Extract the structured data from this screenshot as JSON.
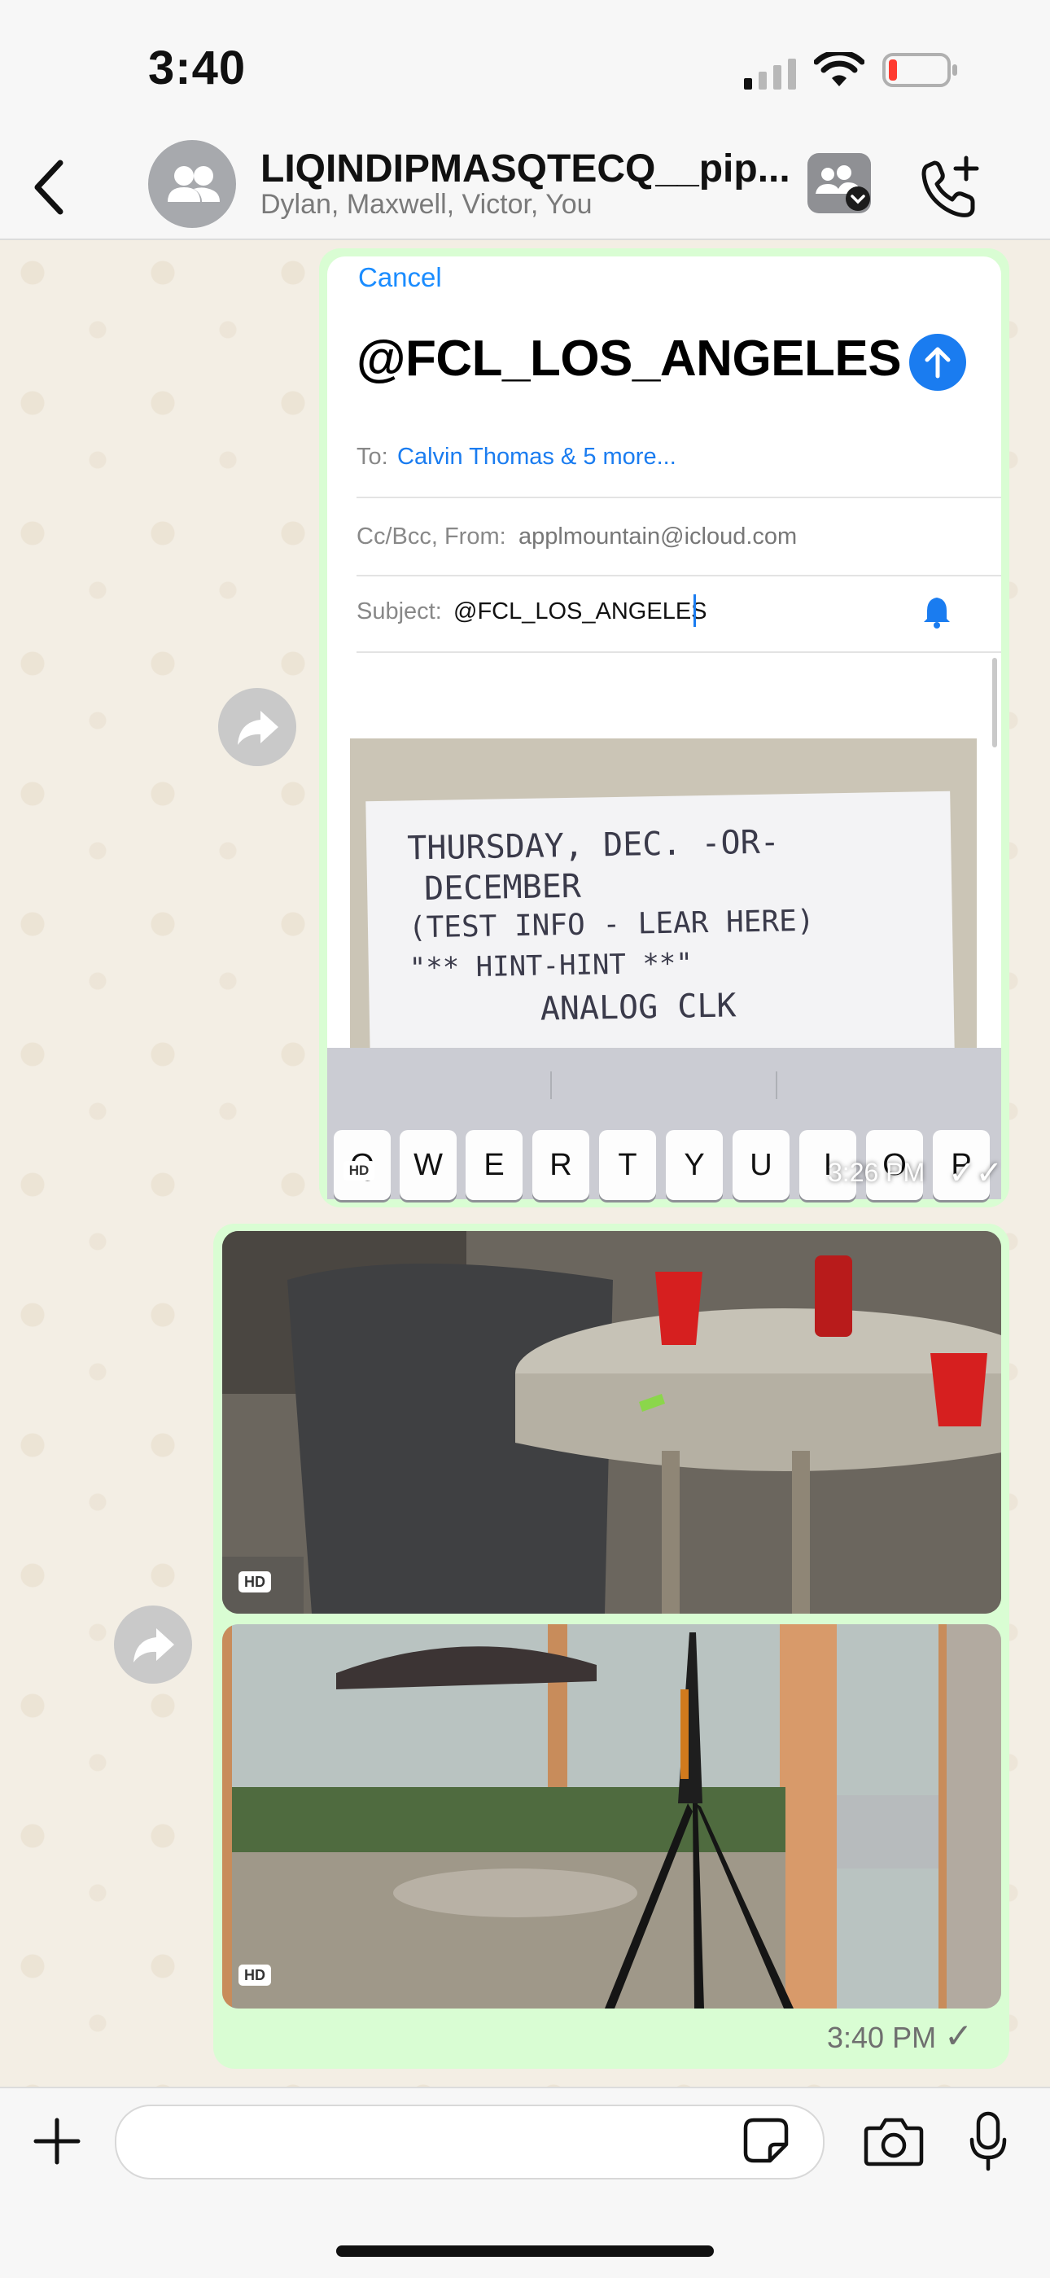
{
  "status_bar": {
    "time": "3:40",
    "icons": [
      "cellular-signal-icon",
      "wifi-icon",
      "battery-low-icon"
    ]
  },
  "header": {
    "title": "LIQINDIPMASQTECQ__pip...",
    "subtitle": "Dylan, Maxwell, Victor, You",
    "back_icon": "chevron-left-icon",
    "avatar_icon": "group-avatar-icon",
    "community_icon": "community-icon",
    "call_icon": "add-call-icon"
  },
  "messages": [
    {
      "type": "image",
      "hd": "HD",
      "time": "3:26 PM",
      "status_icon": "double-check-icon",
      "screenshot": {
        "cancel": "Cancel",
        "heading": "@FCL_LOS_ANGELES",
        "to_label": "To:",
        "to_value": "Calvin Thomas & 5 more...",
        "ccbcc_label": "Cc/Bcc, From:",
        "ccbcc_value": "applmountain@icloud.com",
        "subject_label": "Subject:",
        "subject_value": "@FCL_LOS_ANGELES",
        "note_lines": [
          "THURSDAY, DEC. -OR-",
          "DECEMBER",
          "(TEST INFO - LEAR HERE)",
          "\"** HINT-HINT **\"",
          "ANALOG CLK"
        ],
        "keys": [
          "Q",
          "W",
          "E",
          "R",
          "T",
          "Y",
          "U",
          "I",
          "O",
          "P"
        ]
      }
    },
    {
      "type": "album",
      "photos": [
        {
          "hd": "HD",
          "description_icon": "patio-table-photo"
        },
        {
          "hd": "HD",
          "description_icon": "tripod-patio-photo"
        }
      ],
      "time": "3:40 PM",
      "status_icon": "single-check-icon"
    }
  ],
  "composer": {
    "placeholder": "",
    "plus_icon": "plus-icon",
    "sticker_icon": "sticker-icon",
    "camera_icon": "camera-icon",
    "mic_icon": "microphone-icon"
  },
  "colors": {
    "outgoing_bubble": "#d9fdd3",
    "link_blue": "#1a7cf0",
    "chat_background": "#f3eee4"
  }
}
